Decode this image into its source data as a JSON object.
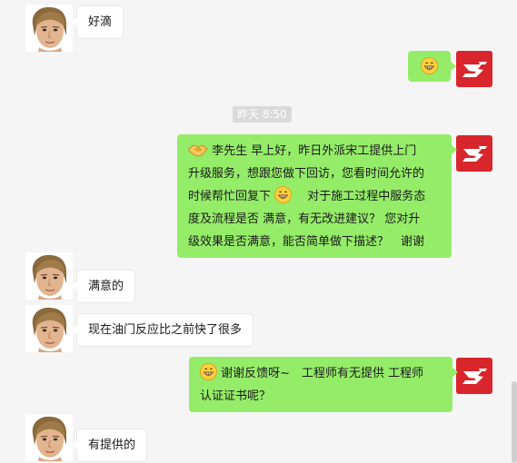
{
  "messages": {
    "m1": "好滴",
    "timestamp": "昨天 8:50",
    "m3_line1": "李先生 早上好，昨日外派宋工提供上门",
    "m3_line2": "升级服务，想跟您做下回访，您看时间允许的",
    "m3_line3a": "时候帮忙回复下",
    "m3_line3b": "　对于施工过程中服务态",
    "m3_line4": "度及流程是否 满意，有无改进建议？  您对升",
    "m3_line5": "级效果是否满意，能否简单做下描述？　谢谢",
    "m4": "满意的",
    "m5": "现在油门反应比之前快了很多",
    "m6_line1": "谢谢反馈呀~　工程师有无提供 工程师",
    "m6_line2": "认证证书呢？",
    "m7": "有提供的"
  },
  "colors": {
    "outgoing_bubble": "#95ec69",
    "incoming_bubble": "#ffffff",
    "brand_red": "#d8262c",
    "background": "#f5f5f5"
  },
  "icons": {
    "customer_avatar": "portrait-avatar",
    "agent_avatar": "red-logo-avatar",
    "grin": "grinning-emoji",
    "handshake": "handshake-emoji"
  }
}
